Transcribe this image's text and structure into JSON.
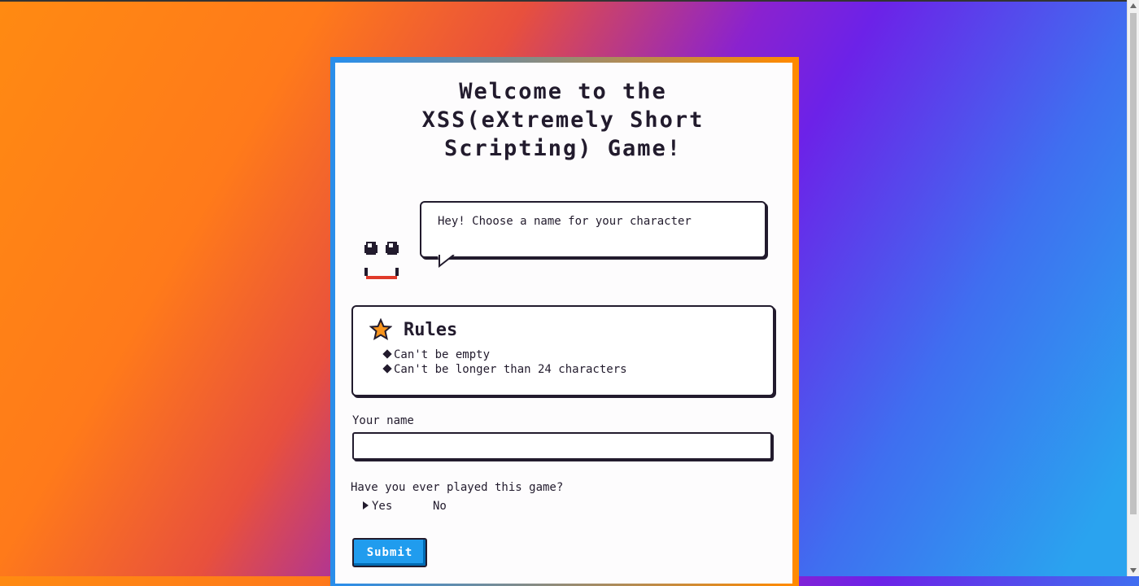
{
  "page": {
    "title_lines": [
      "Welcome to the",
      "XSS(eXtremely Short",
      "Scripting) Game!"
    ]
  },
  "character": {
    "speech": "Hey! Choose a name for your character"
  },
  "rules": {
    "icon": "star-icon",
    "title": "Rules",
    "items": [
      "Can't be empty",
      "Can't be longer than 24 characters"
    ]
  },
  "form": {
    "name_label": "Your name",
    "name_value": "",
    "name_placeholder": "",
    "played_question": "Have you ever played this game?",
    "options": [
      "Yes",
      "No"
    ],
    "selected_option": "Yes",
    "submit_label": "Submit"
  },
  "colors": {
    "primary_button": "#209cee",
    "ink": "#221b2d",
    "star": "#f7941d"
  }
}
